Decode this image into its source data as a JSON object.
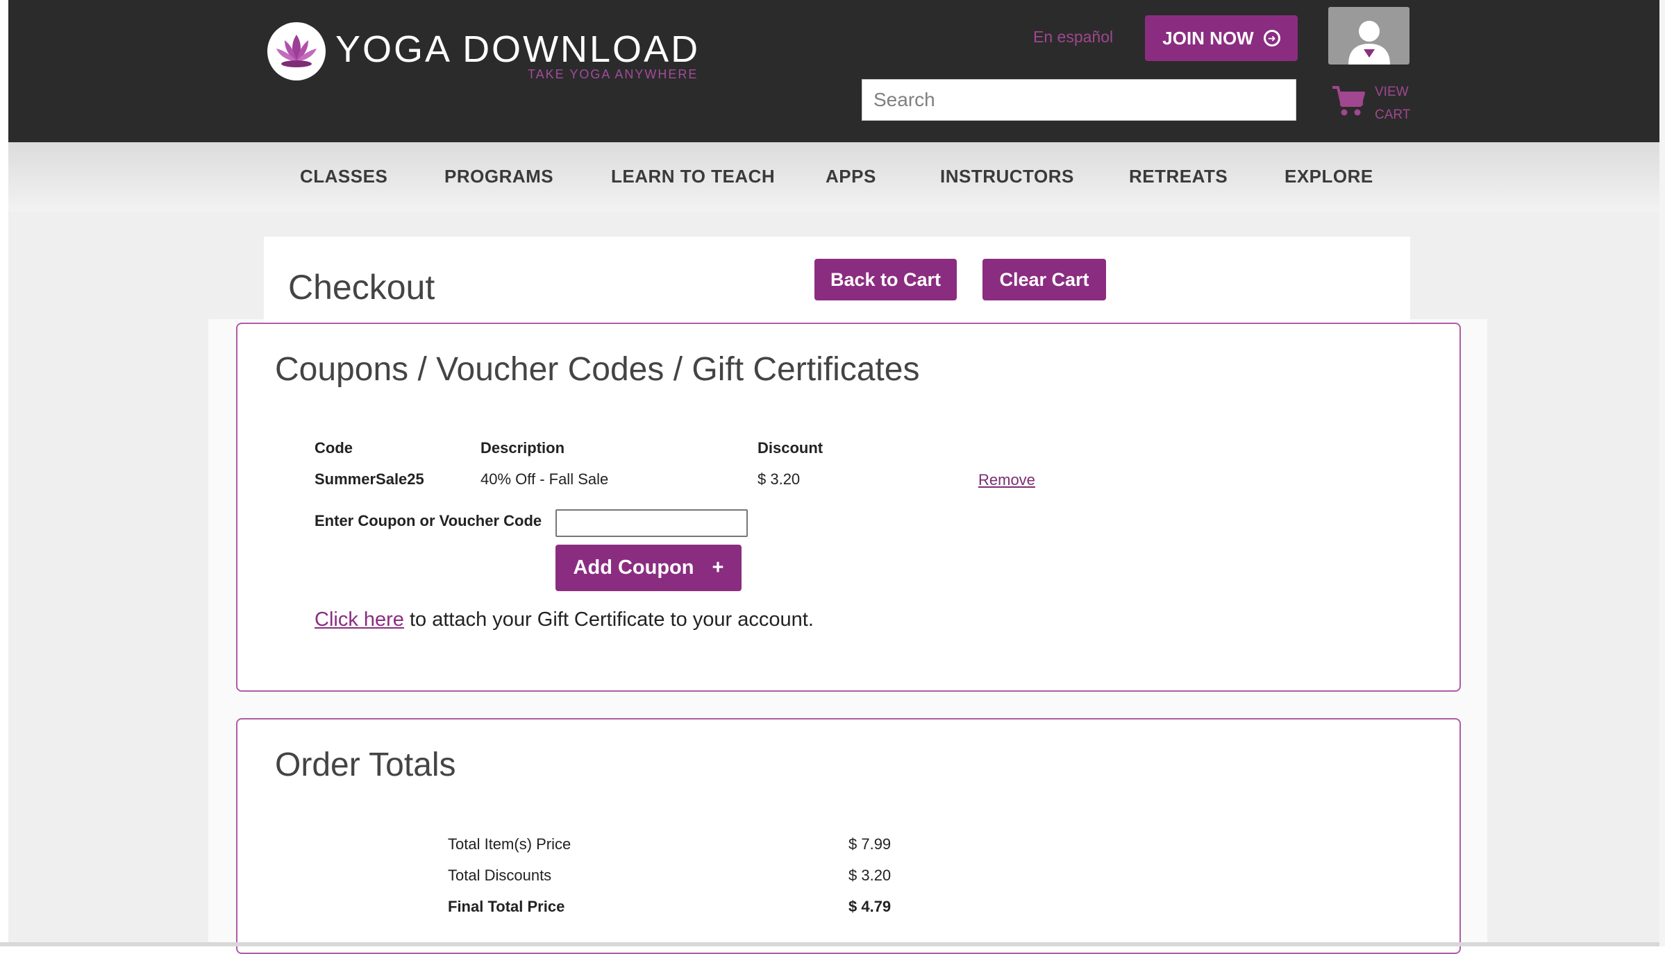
{
  "header": {
    "logo_name": "YOGA DOWNLOAD",
    "logo_tagline": "TAKE YOGA ANYWHERE",
    "language_link": "En español",
    "join_button": "JOIN NOW",
    "search_placeholder": "Search",
    "cart_label": "VIEW CART"
  },
  "nav": {
    "items": [
      "CLASSES",
      "PROGRAMS",
      "LEARN TO TEACH",
      "APPS",
      "INSTRUCTORS",
      "RETREATS",
      "EXPLORE"
    ]
  },
  "checkout": {
    "title": "Checkout",
    "back_button": "Back to Cart",
    "clear_button": "Clear Cart"
  },
  "coupons": {
    "title": "Coupons / Voucher Codes / Gift Certificates",
    "headers": {
      "code": "Code",
      "description": "Description",
      "discount": "Discount"
    },
    "rows": [
      {
        "code": "SummerSale25",
        "description": "40% Off - Fall Sale",
        "discount": "$ 3.20",
        "action": "Remove"
      }
    ],
    "enter_label": "Enter Coupon or Voucher Code",
    "input_value": "",
    "add_button": "Add Coupon",
    "add_button_icon": "+",
    "gift_link": "Click here",
    "gift_text": " to attach your Gift Certificate to your account."
  },
  "totals": {
    "title": "Order Totals",
    "rows": [
      {
        "label": "Total Item(s) Price",
        "value": "$ 7.99"
      },
      {
        "label": "Total Discounts",
        "value": "$ 3.20"
      },
      {
        "label": "Final Total Price",
        "value": "$ 4.79"
      }
    ]
  },
  "colors": {
    "brand_purple": "#8a2d80",
    "header_dark": "#2b2b2b",
    "panel_border": "#b05ba5"
  },
  "icons": [
    "lotus-logo-icon",
    "arrow-circle-icon",
    "user-icon",
    "cart-icon",
    "plus-icon"
  ]
}
